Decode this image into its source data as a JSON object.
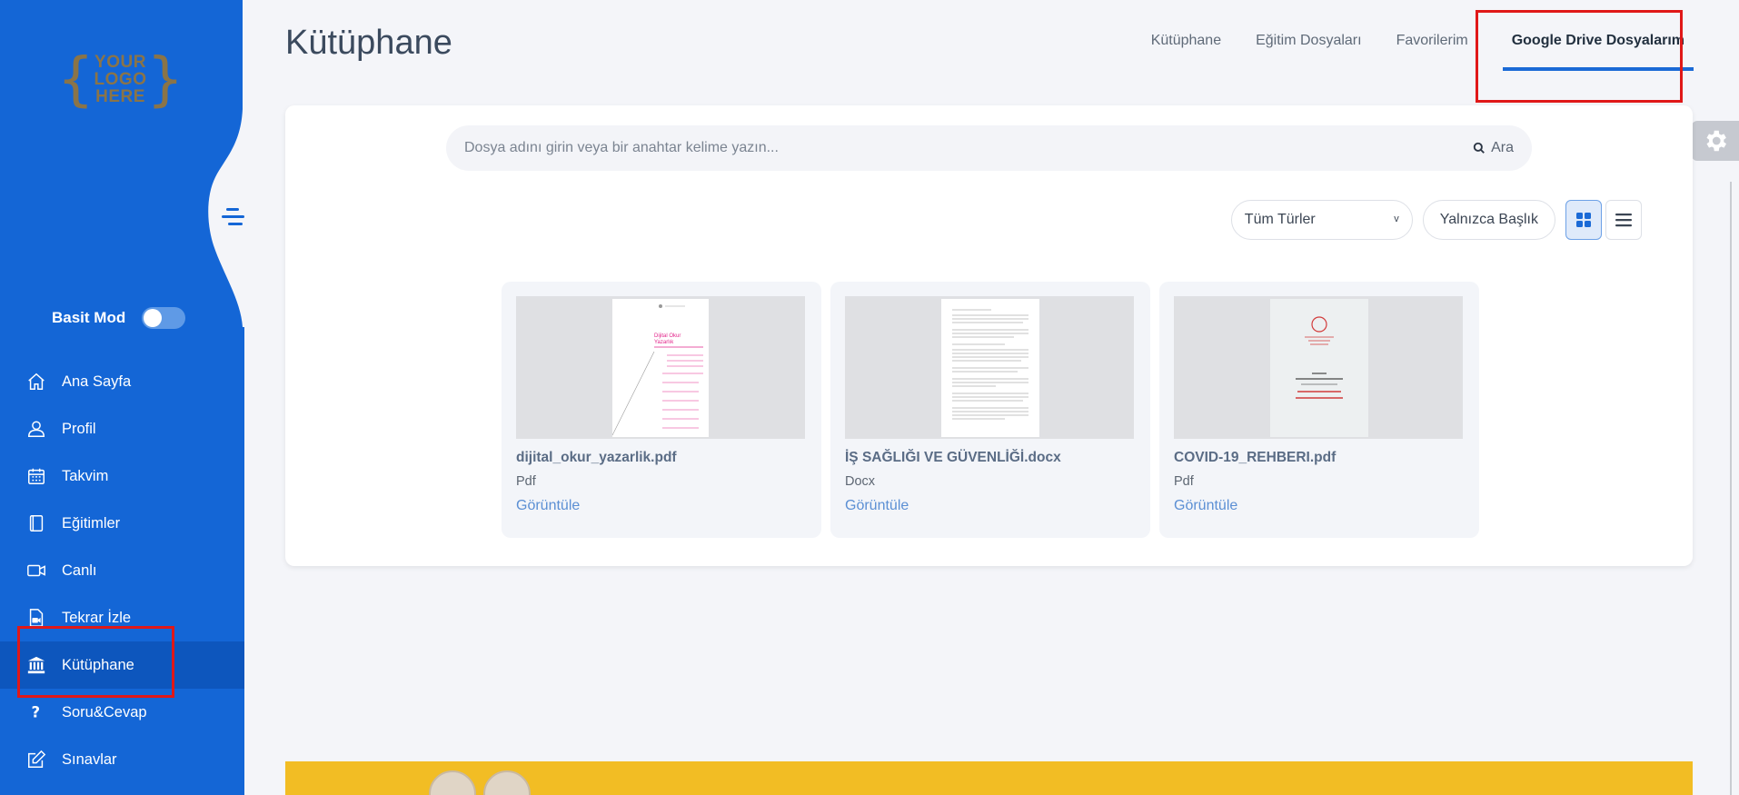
{
  "sidebar": {
    "logo": {
      "line1": "YOUR",
      "line2": "LOGO",
      "line3": "HERE"
    },
    "basic_mode_label": "Basit Mod",
    "items": [
      {
        "label": "Ana Sayfa",
        "icon": "home-icon"
      },
      {
        "label": "Profil",
        "icon": "user-icon"
      },
      {
        "label": "Takvim",
        "icon": "calendar-icon"
      },
      {
        "label": "Eğitimler",
        "icon": "book-icon"
      },
      {
        "label": "Canlı",
        "icon": "video-camera-icon"
      },
      {
        "label": "Tekrar İzle",
        "icon": "video-file-icon"
      },
      {
        "label": "Kütüphane",
        "icon": "library-icon"
      },
      {
        "label": "Soru&Cevap",
        "icon": "question-icon"
      },
      {
        "label": "Sınavlar",
        "icon": "edit-icon"
      }
    ],
    "active_item": "Kütüphane"
  },
  "header": {
    "title": "Kütüphane",
    "tabs": [
      {
        "label": "Kütüphane"
      },
      {
        "label": "Eğitim Dosyaları"
      },
      {
        "label": "Favorilerim"
      },
      {
        "label": "Google Drive Dosyalarım"
      }
    ],
    "active_tab": "Google Drive Dosyalarım"
  },
  "search": {
    "placeholder": "Dosya adını girin veya bir anahtar kelime yazın...",
    "button_label": "Ara"
  },
  "filters": {
    "type_select": "Tüm Türler",
    "title_only": "Yalnızca Başlık"
  },
  "files": [
    {
      "name": "dijital_okur_yazarlik.pdf",
      "type": "Pdf",
      "action": "Görüntüle"
    },
    {
      "name": "İŞ SAĞLIĞI VE GÜVENLİĞİ.docx",
      "type": "Docx",
      "action": "Görüntüle"
    },
    {
      "name": "COVID-19_REHBERI.pdf",
      "type": "Pdf",
      "action": "Görüntüle"
    }
  ],
  "colors": {
    "sidebar": "#1466d6",
    "accent": "#1b6ad6",
    "highlight": "#e01818",
    "banner": "#f2bd24"
  }
}
